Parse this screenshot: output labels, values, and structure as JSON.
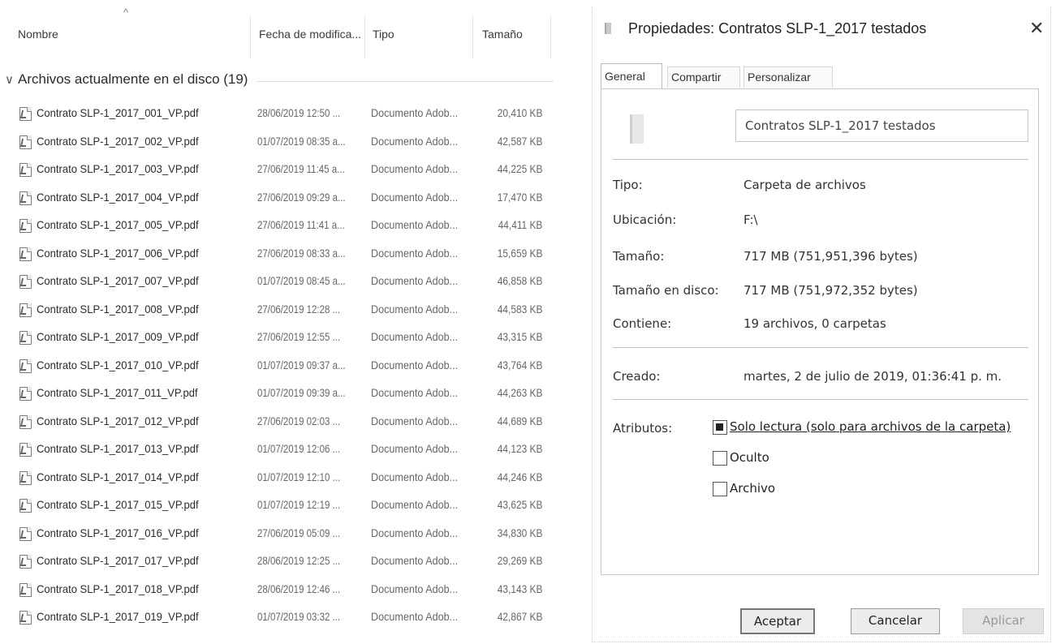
{
  "explorer": {
    "columns": {
      "name": "Nombre",
      "date": "Fecha de modifica...",
      "type": "Tipo",
      "size": "Tamaño",
      "sort_indicator": "^"
    },
    "group": {
      "chevron": "∨",
      "title": "Archivos actualmente en el disco (19)"
    },
    "files": [
      {
        "name": "Contrato SLP-1_2017_001_VP.pdf",
        "date": "28/06/2019 12:50 ...",
        "type": "Documento Adob...",
        "size": "20,410 KB"
      },
      {
        "name": "Contrato SLP-1_2017_002_VP.pdf",
        "date": "01/07/2019 08:35 a...",
        "type": "Documento Adob...",
        "size": "42,587 KB"
      },
      {
        "name": "Contrato SLP-1_2017_003_VP.pdf",
        "date": "27/06/2019 11:45 a...",
        "type": "Documento Adob...",
        "size": "44,225 KB"
      },
      {
        "name": "Contrato SLP-1_2017_004_VP.pdf",
        "date": "27/06/2019 09:29 a...",
        "type": "Documento Adob...",
        "size": "17,470 KB"
      },
      {
        "name": "Contrato SLP-1_2017_005_VP.pdf",
        "date": "27/06/2019 11:41 a...",
        "type": "Documento Adob...",
        "size": "44,411 KB"
      },
      {
        "name": "Contrato SLP-1_2017_006_VP.pdf",
        "date": "27/06/2019 08:33 a...",
        "type": "Documento Adob...",
        "size": "15,659 KB"
      },
      {
        "name": "Contrato SLP-1_2017_007_VP.pdf",
        "date": "01/07/2019 08:45 a...",
        "type": "Documento Adob...",
        "size": "46,858 KB"
      },
      {
        "name": "Contrato SLP-1_2017_008_VP.pdf",
        "date": "27/06/2019 12:28 ...",
        "type": "Documento Adob...",
        "size": "44,583 KB"
      },
      {
        "name": "Contrato SLP-1_2017_009_VP.pdf",
        "date": "27/06/2019 12:55 ...",
        "type": "Documento Adob...",
        "size": "43,315 KB"
      },
      {
        "name": "Contrato SLP-1_2017_010_VP.pdf",
        "date": "01/07/2019 09:37 a...",
        "type": "Documento Adob...",
        "size": "43,764 KB"
      },
      {
        "name": "Contrato SLP-1_2017_011_VP.pdf",
        "date": "01/07/2019 09:39 a...",
        "type": "Documento Adob...",
        "size": "44,263 KB"
      },
      {
        "name": "Contrato SLP-1_2017_012_VP.pdf",
        "date": "27/06/2019 02:03 ...",
        "type": "Documento Adob...",
        "size": "44,689 KB"
      },
      {
        "name": "Contrato SLP-1_2017_013_VP.pdf",
        "date": "01/07/2019 12:06 ...",
        "type": "Documento Adob...",
        "size": "44,123 KB"
      },
      {
        "name": "Contrato SLP-1_2017_014_VP.pdf",
        "date": "01/07/2019 12:10 ...",
        "type": "Documento Adob...",
        "size": "44,246 KB"
      },
      {
        "name": "Contrato SLP-1_2017_015_VP.pdf",
        "date": "01/07/2019 12:19 ...",
        "type": "Documento Adob...",
        "size": "43,625 KB"
      },
      {
        "name": "Contrato SLP-1_2017_016_VP.pdf",
        "date": "27/06/2019 05:09 ...",
        "type": "Documento Adob...",
        "size": "34,830 KB"
      },
      {
        "name": "Contrato SLP-1_2017_017_VP.pdf",
        "date": "28/06/2019 12:25 ...",
        "type": "Documento Adob...",
        "size": "29,269 KB"
      },
      {
        "name": "Contrato SLP-1_2017_018_VP.pdf",
        "date": "28/06/2019 12:46 ...",
        "type": "Documento Adob...",
        "size": "43,143 KB"
      },
      {
        "name": "Contrato SLP-1_2017_019_VP.pdf",
        "date": "01/07/2019 03:32 ...",
        "type": "Documento Adob...",
        "size": "42,867 KB"
      }
    ]
  },
  "dialog": {
    "title": "Propiedades: Contratos SLP-1_2017 testados",
    "close_glyph": "✕",
    "tabs": [
      {
        "label": "General",
        "active": true
      },
      {
        "label": "Compartir",
        "active": false
      },
      {
        "label": "Personalizar",
        "active": false
      }
    ],
    "folder_name": "Contratos SLP-1_2017 testados",
    "props": {
      "type_label": "Tipo:",
      "type_value": "Carpeta de archivos",
      "location_label": "Ubicación:",
      "location_value": "F:\\",
      "size_label": "Tamaño:",
      "size_value": "717 MB (751,951,396 bytes)",
      "disk_size_label": "Tamaño en disco:",
      "disk_size_value": "717 MB (751,972,352 bytes)",
      "contains_label": "Contiene:",
      "contains_value": "19 archivos, 0 carpetas",
      "created_label": "Creado:",
      "created_value": "martes, 2 de julio de 2019, 01:36:41 p. m."
    },
    "attributes": {
      "label": "Atributos:",
      "readonly": {
        "label": "Solo lectura (solo para archivos de la carpeta)",
        "state": "indeterminate"
      },
      "hidden": {
        "label": "Oculto",
        "state": "unchecked"
      },
      "archive": {
        "label": "Archivo",
        "state": "unchecked"
      }
    },
    "buttons": {
      "ok": "Aceptar",
      "cancel": "Cancelar",
      "apply": "Aplicar"
    }
  }
}
